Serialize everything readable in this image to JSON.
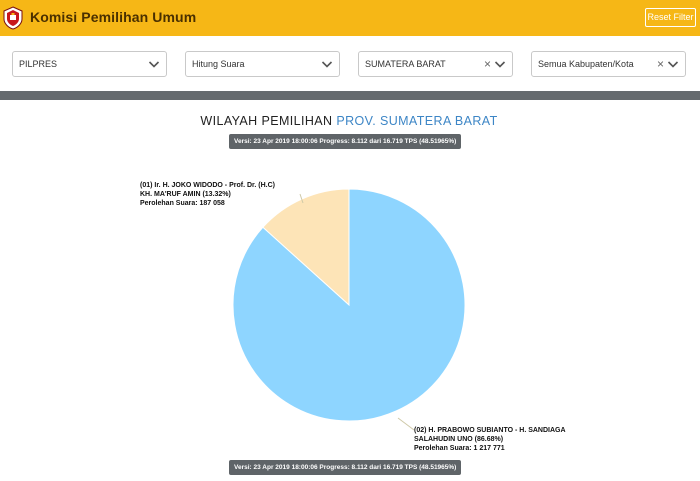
{
  "header": {
    "title": "Komisi Pemilihan Umum",
    "reset_label": "Reset Filter"
  },
  "filters": {
    "election": "PILPRES",
    "mode": "Hitung Suara",
    "province": "SUMATERA BARAT",
    "regency": "Semua Kabupaten/Kota"
  },
  "content": {
    "title_prefix": "WILAYAH PEMILIHAN",
    "title_region": "PROV. SUMATERA BARAT",
    "version_text": "Versi: 23 Apr 2019 18:00:06 Progress: 8.112 dari 16.719 TPS (48.51965%)"
  },
  "colors": {
    "brand": "#f6b716",
    "candidate_01": "#fde4b7",
    "candidate_02": "#8ed5ff"
  },
  "chart_data": {
    "type": "pie",
    "title": "",
    "series": [
      {
        "number": "(01)",
        "line1": "(01) Ir. H. JOKO WIDODO - Prof. Dr. (H.C)",
        "line2": "KH. MA'RUF AMIN (13.32%)",
        "votes_text": "Perolehan Suara: 187 058",
        "percent": 13.32,
        "votes": 187058
      },
      {
        "number": "(02)",
        "line1": "(02) H. PRABOWO SUBIANTO - H. SANDIAGA",
        "line2": "SALAHUDIN UNO (86.68%)",
        "votes_text": "Perolehan Suara: 1 217 771",
        "percent": 86.68,
        "votes": 1217771
      }
    ]
  }
}
